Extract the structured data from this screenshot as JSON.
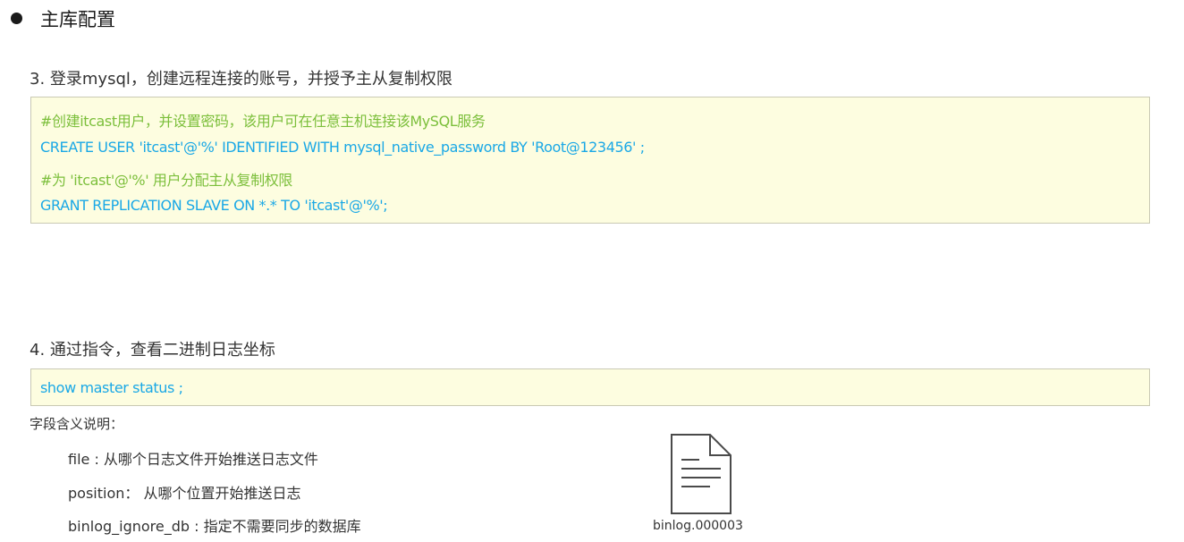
{
  "header": {
    "title": "主库配置"
  },
  "step3": {
    "title": "3. 登录mysql，创建远程连接的账号，并授予主从复制权限",
    "code_lines": [
      "#创建itcast用户，并设置密码，该用户可在任意主机连接该MySQL服务",
      "CREATE  USER  'itcast'@'%' IDENTIFIED WITH mysql_native_password BY 'Root@123456' ;",
      "#为 'itcast'@'%' 用户分配主从复制权限",
      "GRANT  REPLICATION  SLAVE  ON  *.*  TO  'itcast'@'%';"
    ]
  },
  "step4": {
    "title": "4. 通过指令，查看二进制日志坐标",
    "code": "show  master  status ;",
    "desc_title": "字段含义说明：",
    "fields": [
      "file : 从哪个日志文件开始推送日志文件",
      "position：  从哪个位置开始推送日志",
      "binlog_ignore_db : 指定不需要同步的数据库"
    ]
  },
  "file": {
    "icon": "document-icon",
    "label": "binlog.000003"
  },
  "colors": {
    "comment": "#7cbf3b",
    "code": "#1aa8e6",
    "code_bg": "#fdfde0"
  }
}
